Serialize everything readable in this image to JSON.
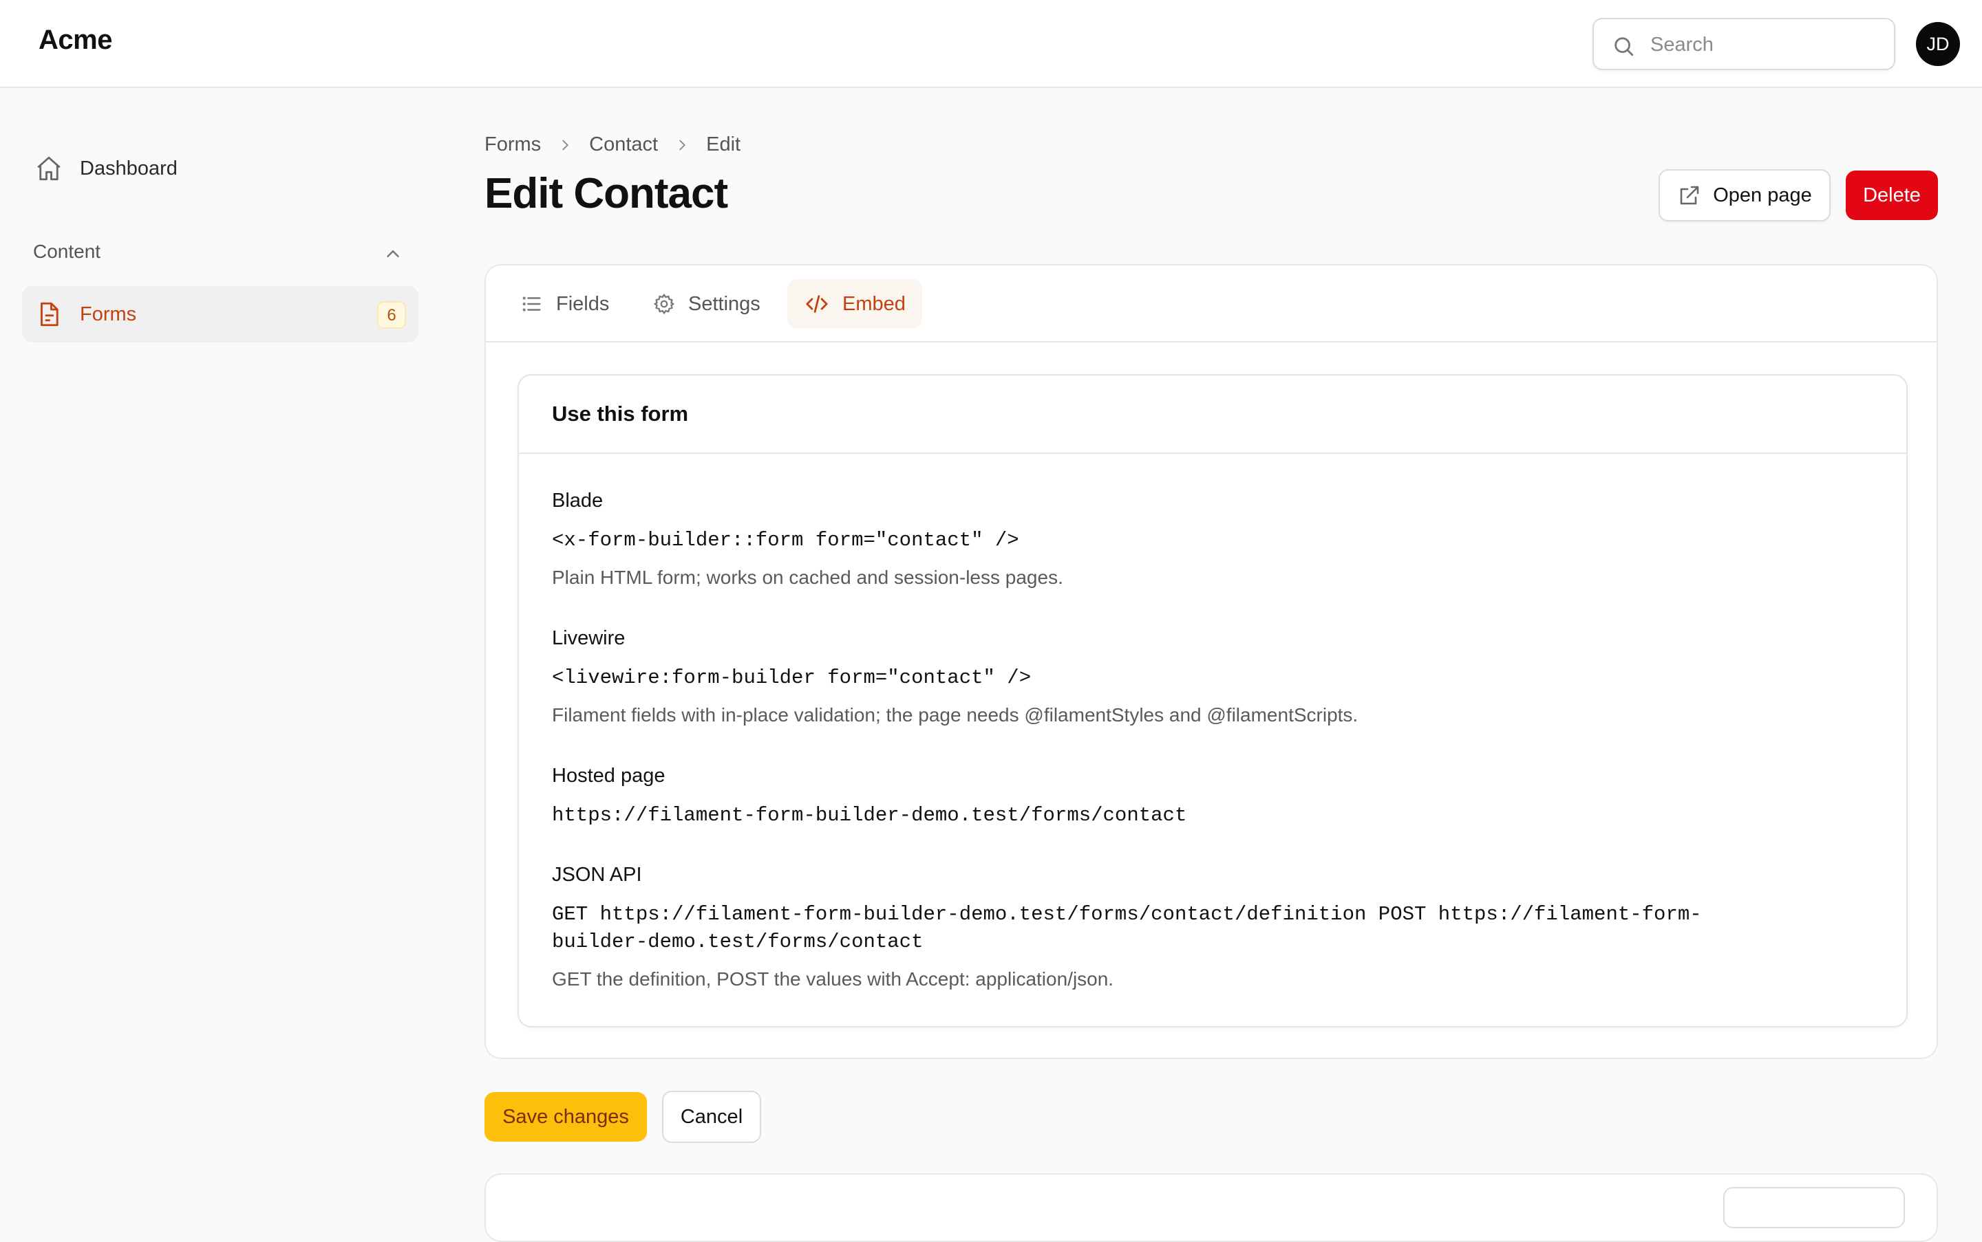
{
  "app": {
    "brand": "Acme"
  },
  "header": {
    "search": {
      "placeholder": "Search",
      "value": ""
    },
    "avatar_initials": "JD"
  },
  "sidebar": {
    "dashboard": {
      "label": "Dashboard",
      "icon": "home-icon"
    },
    "group": {
      "title": "Content",
      "expanded": true
    },
    "forms": {
      "label": "Forms",
      "badge": "6",
      "icon": "document-icon",
      "active": true
    }
  },
  "breadcrumb": [
    "Forms",
    "Contact",
    "Edit"
  ],
  "page": {
    "title": "Edit Contact"
  },
  "actions": {
    "open_page": "Open page",
    "delete": "Delete"
  },
  "tabs": [
    {
      "label": "Fields",
      "icon": "list-icon",
      "active": false
    },
    {
      "label": "Settings",
      "icon": "gear-icon",
      "active": false
    },
    {
      "label": "Embed",
      "icon": "code-icon",
      "active": true
    }
  ],
  "embed": {
    "title": "Use this form",
    "sections": [
      {
        "label": "Blade",
        "code": "<x-form-builder::form form=\"contact\" />",
        "description": "Plain HTML form; works on cached and session-less pages."
      },
      {
        "label": "Livewire",
        "code": "<livewire:form-builder form=\"contact\" />",
        "description": "Filament fields with in-place validation; the page needs @filamentStyles and @filamentScripts."
      },
      {
        "label": "Hosted page",
        "code": "https://filament-form-builder-demo.test/forms/contact",
        "description": ""
      },
      {
        "label": "JSON API",
        "code": "GET https://filament-form-builder-demo.test/forms/contact/definition POST https://filament-form-builder-demo.test/forms/contact",
        "description": "GET the definition, POST the values with Accept: application/json."
      }
    ]
  },
  "footer_actions": {
    "save": "Save changes",
    "cancel": "Cancel"
  },
  "colors": {
    "accent": "#c2410c",
    "danger": "#e30613",
    "primary": "#fbbf0c"
  }
}
